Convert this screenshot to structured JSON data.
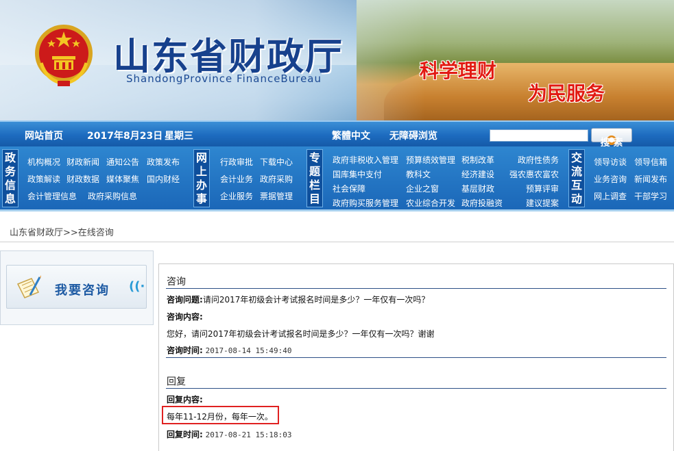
{
  "banner": {
    "title": "山东省财政厅",
    "subtitle": "ShandongProvince FinanceBureau",
    "slogan_1": "科学理财",
    "slogan_2": "为民服务"
  },
  "topbar": {
    "home": "网站首页",
    "date": "2017年8月23日",
    "weekday": "星期三",
    "traditional": "繁體中文",
    "accessible": "无障碍浏览",
    "search_value": "",
    "search_button": "搜 索"
  },
  "nav": {
    "groups": [
      {
        "label": "政务信息",
        "links": [
          "机构概况",
          "财政新闻",
          "通知公告",
          "政策发布",
          "政策解读",
          "财政数据",
          "媒体聚焦",
          "国内财经",
          "会计管理信息",
          "政府采购信息"
        ]
      },
      {
        "label": "网上办事",
        "links": [
          "行政审批",
          "下载中心",
          "会计业务",
          "政府采购",
          "企业服务",
          "票据管理"
        ]
      },
      {
        "label": "专题栏目",
        "links": [
          "政府非税收入管理",
          "预算绩效管理",
          "税制改革",
          "政府性债务",
          "国库集中支付",
          "教科文",
          "经济建设",
          "强农惠农富农",
          "社会保障",
          "企业之窗",
          "基层财政",
          "预算评审",
          "政府购买服务管理",
          "农业综合开发",
          "政府投融资",
          "建议提案"
        ]
      },
      {
        "label": "交流互动",
        "links": [
          "领导访谈",
          "领导信箱",
          "业务咨询",
          "新闻发布",
          "网上调查",
          "干部学习"
        ]
      }
    ]
  },
  "breadcrumb": "山东省财政厅>>在线咨询",
  "left": {
    "consult_button": "我要咨询"
  },
  "consult": {
    "section_title": "咨询",
    "question_label": "咨询问题:",
    "question": "请问2017年初级会计考试报名时间是多少？一年仅有一次吗？",
    "content_label": "咨询内容:",
    "content": "您好，请问2017年初级会计考试报名时间是多少？一年仅有一次吗？谢谢",
    "time_label": "咨询时间:",
    "time": "2017-08-14 15:49:40"
  },
  "reply": {
    "section_title": "回复",
    "content_label": "回复内容:",
    "content": "每年11-12月份，每年一次。",
    "time_label": "回复时间:",
    "time": "2017-08-21 15:18:03"
  },
  "colors": {
    "nav_blue": "#1d6bbf",
    "title_blue": "#17418d",
    "slogan_red": "#e21a12",
    "highlight_red": "#e02020"
  },
  "icons": [
    "national-emblem-icon",
    "search-icon",
    "document-pencil-icon",
    "signal-wave-icon"
  ]
}
